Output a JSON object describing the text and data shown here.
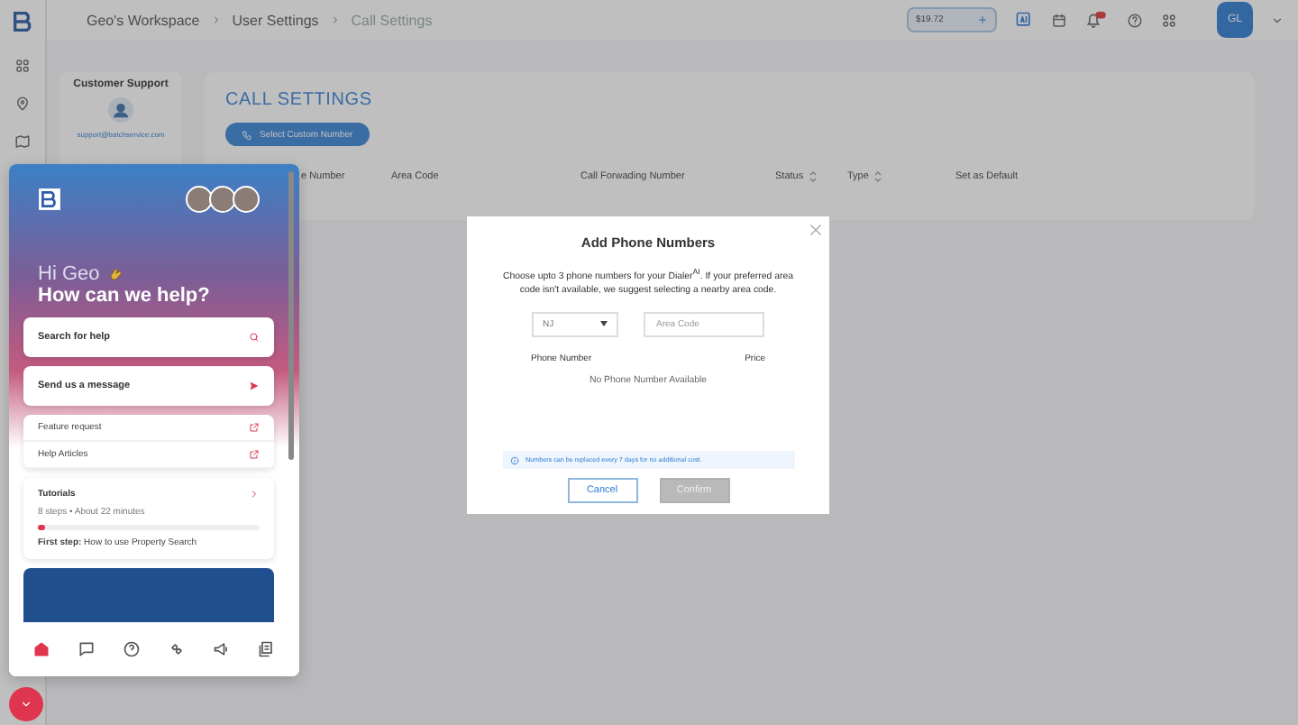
{
  "breadcrumb": [
    {
      "label": "Geo's Workspace",
      "selected": false
    },
    {
      "label": "User Settings",
      "selected": false
    },
    {
      "label": "Call Settings",
      "selected": true
    }
  ],
  "balance": "$19.72",
  "avatar": "GL",
  "support": {
    "title": "Customer Support",
    "email": "support@batchservice.com"
  },
  "call_settings": {
    "title": "CALL SETTINGS",
    "button": "Select Custom Number",
    "columns": [
      {
        "label": "e Number",
        "sortable": false
      },
      {
        "label": "Area Code",
        "sortable": false
      },
      {
        "label": "Call Forwading Number",
        "sortable": false
      },
      {
        "label": "Status",
        "sortable": true
      },
      {
        "label": "Type",
        "sortable": true
      },
      {
        "label": "Set as Default",
        "sortable": false
      }
    ]
  },
  "modal": {
    "title": "Add Phone Numbers",
    "intro": "Choose upto 3 phone numbers for your Dialer$^{AI}$. If your preferred area code isn't available, we suggest selecting a nearby area code.",
    "state": "NJ",
    "area_code_placeholder": "Area Code",
    "columns": [
      "Phone Number",
      "Price"
    ],
    "empty": "No Phone Number Available",
    "note": "Numbers can be replaced every 7 days for no additional cost.",
    "cancel": "Cancel",
    "confirm": {
      "label": "Confirm",
      "disabled": true
    }
  },
  "help_widget": {
    "greeting": "Hi Geo",
    "question": "How can we help?",
    "search_placeholder": "Search for help",
    "message": "Send us a message",
    "links": [
      "Feature request",
      "Help Articles"
    ],
    "tutorials": {
      "title": "Tutorials",
      "meta": "8 steps • About 22 minutes",
      "level": 0.03,
      "first_step": "**First step:** How to use Property Search"
    },
    "nav": [
      {
        "selected": true
      },
      {
        "selected": false
      },
      {
        "selected": false
      },
      {
        "selected": false
      },
      {
        "selected": false
      },
      {
        "selected": false
      }
    ]
  }
}
